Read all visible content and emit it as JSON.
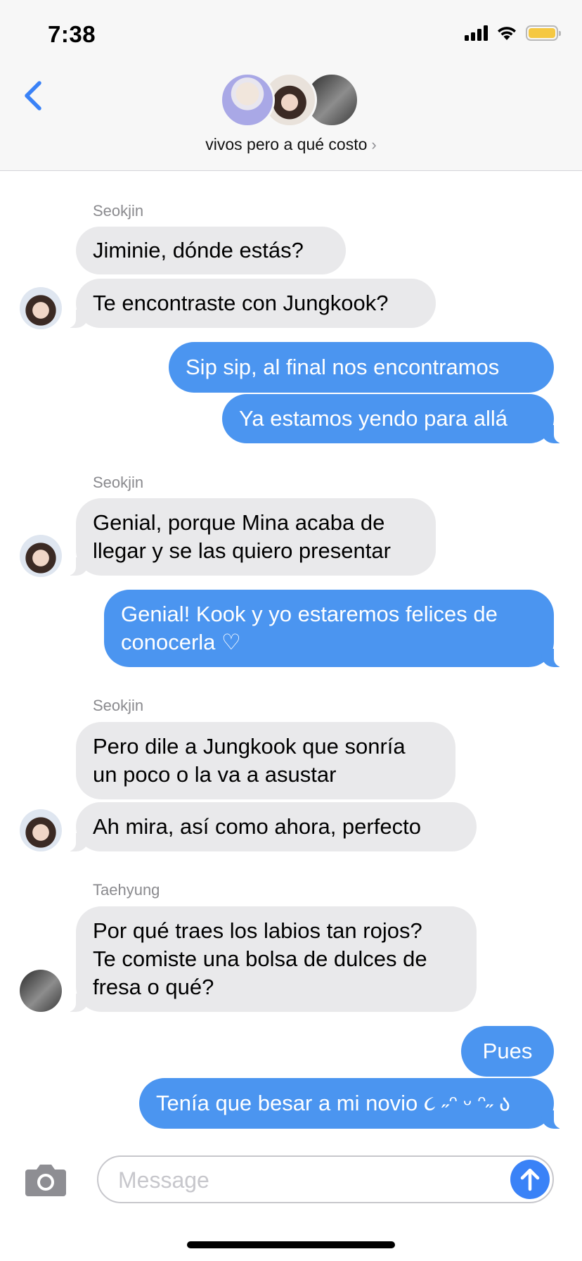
{
  "status": {
    "time": "7:38"
  },
  "header": {
    "group_name": "vivos pero a qué costo",
    "chevron": "›"
  },
  "messages": [
    {
      "sender": "Seokjin"
    },
    {
      "text": "Jiminie, dónde estás?"
    },
    {
      "text": "Te encontraste con Jungkook?"
    },
    {
      "text": "Sip sip, al final nos encontramos"
    },
    {
      "text": "Ya estamos yendo para allá"
    },
    {
      "sender": "Seokjin"
    },
    {
      "line1": "Genial, porque Mina acaba de",
      "line2": "llegar y se las quiero presentar"
    },
    {
      "line1": "Genial! Kook y yo estaremos felices de",
      "line2": "conocerla ♡"
    },
    {
      "sender": "Seokjin"
    },
    {
      "line1": "Pero dile a Jungkook que sonría",
      "line2": "un poco o la va a asustar"
    },
    {
      "text": "Ah mira, así como ahora, perfecto"
    },
    {
      "sender": "Taehyung"
    },
    {
      "line1": "Por qué traes los labios tan rojos?",
      "line2": "Te comiste una bolsa de dulces de",
      "line3": "fresa o qué?"
    },
    {
      "text": "Pues"
    },
    {
      "text": "Tenía que besar a mi novio ૮ ˶ᵔ ᵕ ᵔ˶ ა"
    }
  ],
  "compose": {
    "placeholder": "Message"
  },
  "colors": {
    "incoming": "#e9e9eb",
    "outgoing": "#4b95f0",
    "send": "#3a82f7",
    "accent": "#3a82f7"
  },
  "icons": [
    "back-chevron-icon",
    "camera-icon",
    "send-arrow-icon",
    "signal-icon",
    "wifi-icon",
    "battery-icon"
  ]
}
